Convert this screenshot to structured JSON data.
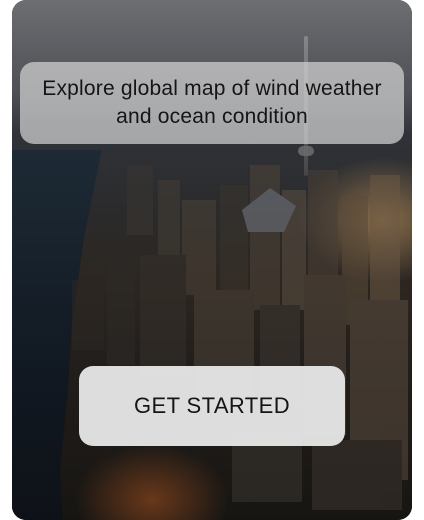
{
  "hero": {
    "headline": "Explore global map of wind weather and ocean condition",
    "background_image": "aerial-city-skyline-photo"
  },
  "actions": {
    "primary_label": "GET STARTED"
  },
  "colors": {
    "overlay": "#d2d2d2",
    "button": "#e8e8e8",
    "text": "#151515"
  }
}
